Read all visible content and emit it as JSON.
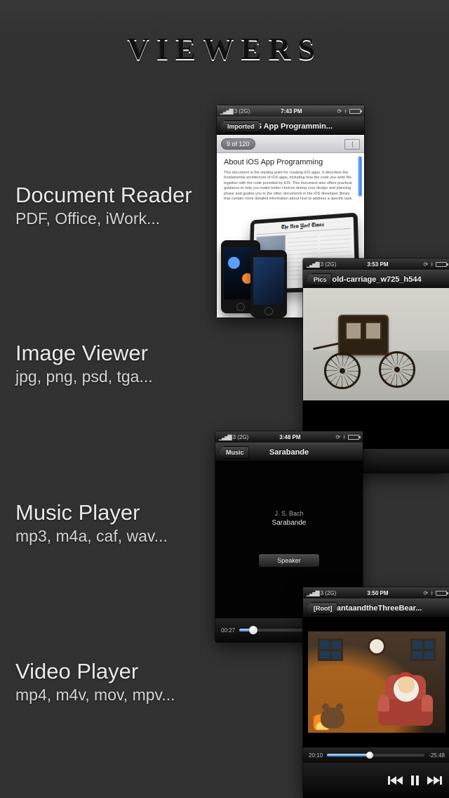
{
  "title": "Viewers",
  "sections": {
    "doc": {
      "title": "Document Reader",
      "subtitle": "PDF, Office, iWork..."
    },
    "image": {
      "title": "Image Viewer",
      "subtitle": "jpg, png, psd, tga..."
    },
    "music": {
      "title": "Music Player",
      "subtitle": "mp3, m4a, caf, wav..."
    },
    "video": {
      "title": "Video Player",
      "subtitle": "mp4, m4v, mov, mpv..."
    }
  },
  "doc_phone": {
    "carrier": "3 (2G)",
    "time": "7:43 PM",
    "back_label": "Imported",
    "nav_title": "iOS App Programmin...",
    "page_indicator": "9 of 120",
    "heading": "About iOS App Programming",
    "body_excerpt": "This document is the starting point for creating iOS apps. It describes the fundamental architecture of iOS apps, including how the code you write fits together with the code provided by iOS. This document also offers practical guidance to help you make better choices during your design and planning phase and guides you to the other documents in the iOS developer library that contain more detailed information about how to address a specific task.",
    "newspaper_masthead": "The New York Times"
  },
  "img_phone": {
    "carrier": "3 (2G)",
    "time": "3:53 PM",
    "back_label": "Pics",
    "nav_title": "old-carriage_w725_h544"
  },
  "music_phone": {
    "carrier": "3 (2G)",
    "time": "3:48 PM",
    "back_label": "Music",
    "nav_title": "Sarabande",
    "artist": "J. S. Bach",
    "track": "Sarabande",
    "speaker_label": "Speaker",
    "elapsed": "00:27"
  },
  "video_phone": {
    "carrier": "3 (2G)",
    "time": "3:50 PM",
    "back_label": "[Root]",
    "nav_title": "SantaandtheThreeBear...",
    "elapsed": "20:10",
    "remaining": "-25:48"
  }
}
